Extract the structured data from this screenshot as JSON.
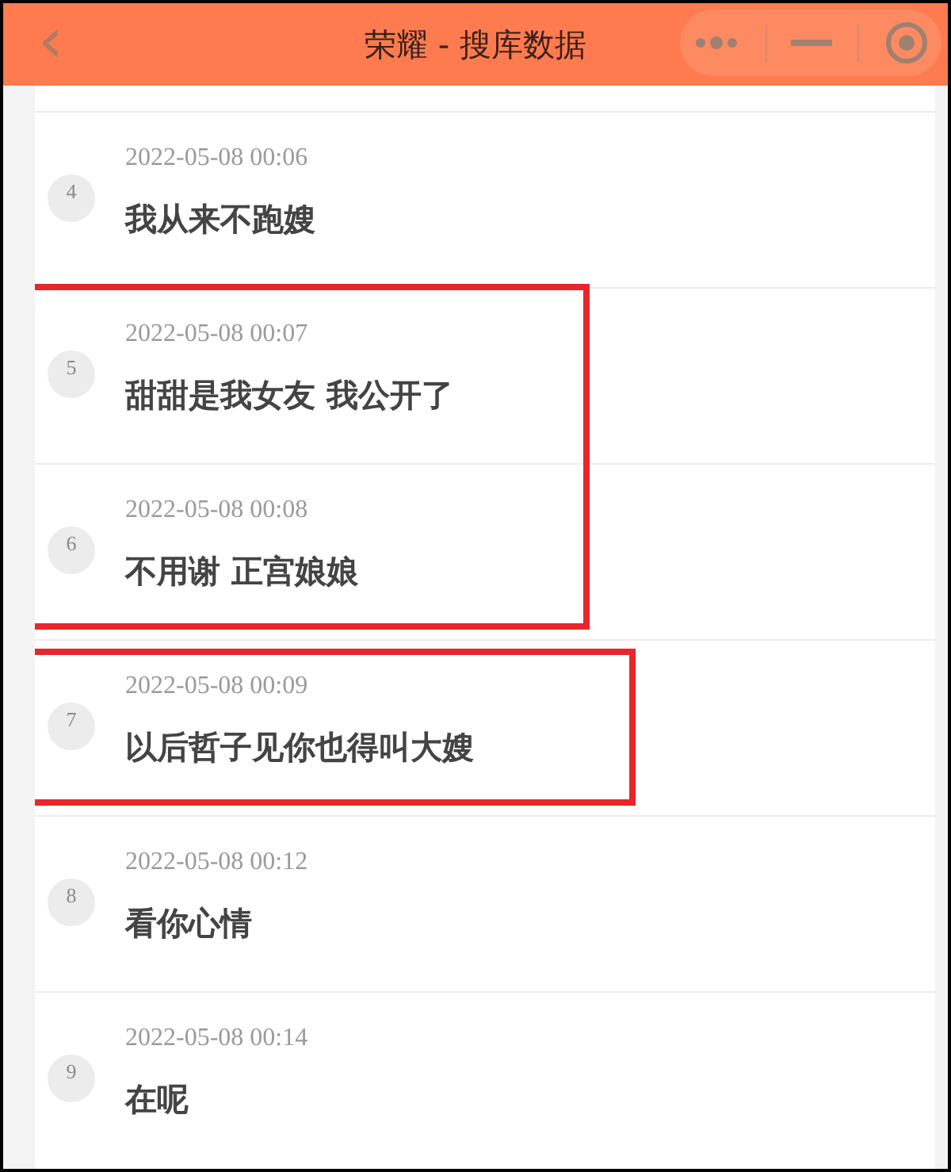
{
  "header": {
    "back": "‹",
    "title": "荣耀 - 搜库数据"
  },
  "groups": [
    {
      "highlighted": false,
      "messages": [
        {
          "number": "4",
          "time": "2022-05-08 00:06",
          "text": "我从来不跑嫂"
        }
      ]
    },
    {
      "highlighted": true,
      "messages": [
        {
          "number": "5",
          "time": "2022-05-08 00:07",
          "text": "甜甜是我女友 我公开了"
        },
        {
          "number": "6",
          "time": "2022-05-08 00:08",
          "text": "不用谢 正宫娘娘"
        }
      ]
    },
    {
      "highlighted": true,
      "messages": [
        {
          "number": "7",
          "time": "2022-05-08 00:09",
          "text": "以后哲子见你也得叫大嫂"
        }
      ]
    },
    {
      "highlighted": false,
      "messages": [
        {
          "number": "8",
          "time": "2022-05-08 00:12",
          "text": "看你心情"
        },
        {
          "number": "9",
          "time": "2022-05-08 00:14",
          "text": "在呢"
        }
      ]
    }
  ]
}
